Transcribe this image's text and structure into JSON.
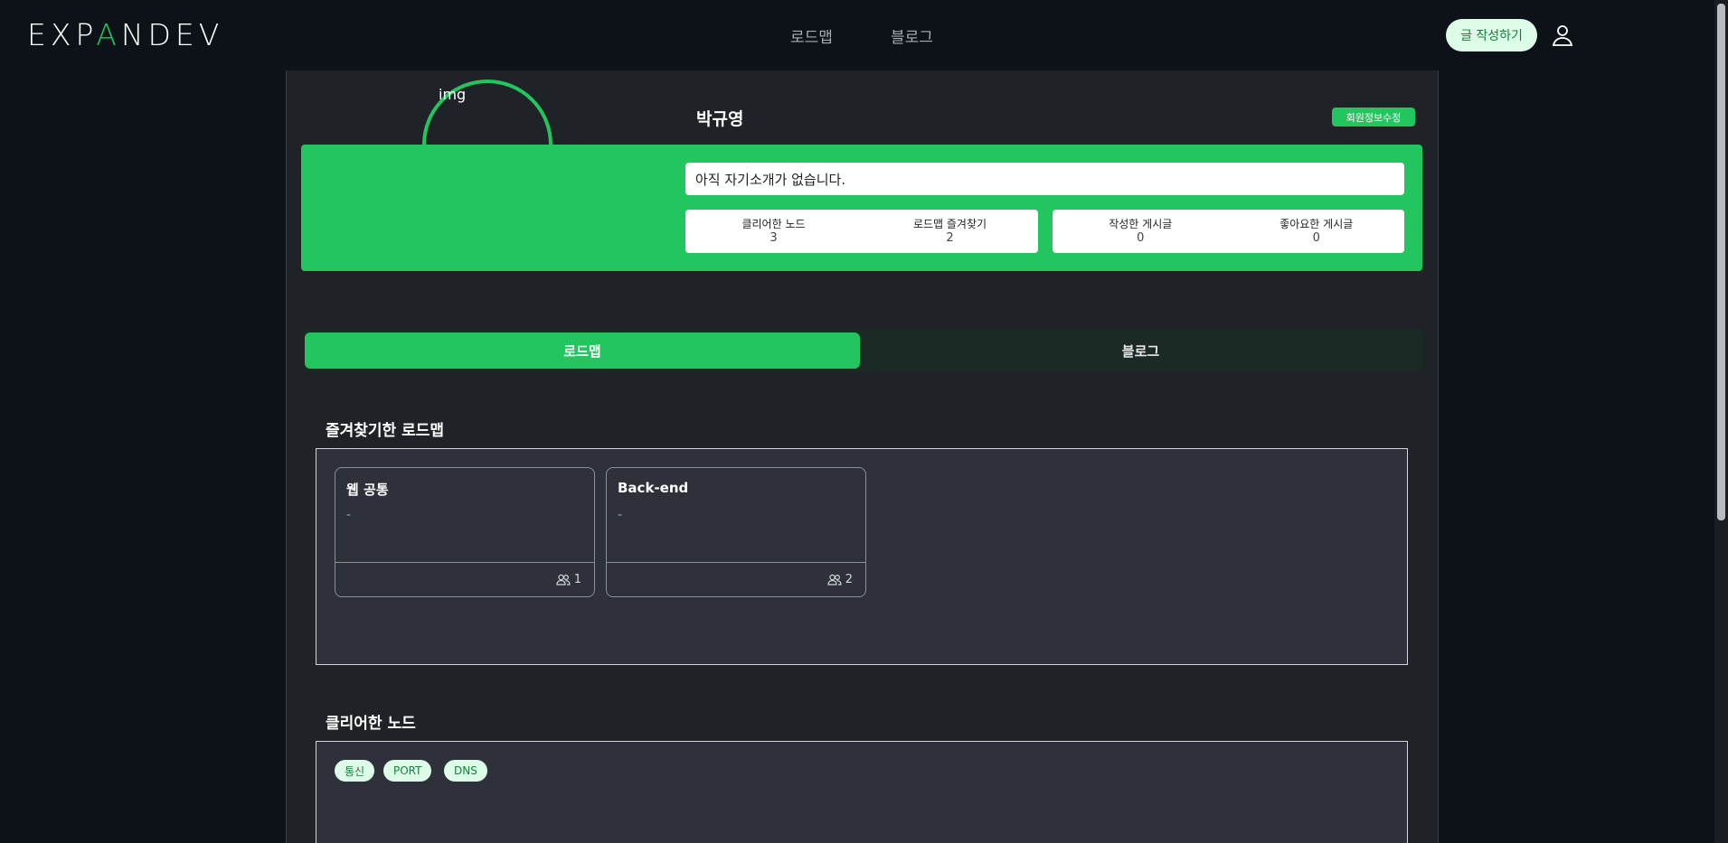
{
  "header": {
    "logo_pre": "EXP",
    "logo_accent": "A",
    "logo_post": "NDEV",
    "nav": {
      "roadmap": "로드맵",
      "blog": "블로그"
    },
    "write_button": "글 작성하기",
    "user_icon": "user-icon"
  },
  "profile": {
    "avatar_alt": "img",
    "name": "박규영",
    "edit_button": "회원정보수정",
    "intro": "아직 자기소개가 없습니다.",
    "stats": [
      {
        "label": "클리어한 노드",
        "value": "3"
      },
      {
        "label": "로드맵 즐겨찾기",
        "value": "2"
      },
      {
        "label": "작성한 게시글",
        "value": "0"
      },
      {
        "label": "좋아요한 게시글",
        "value": "0"
      }
    ]
  },
  "tabs": {
    "roadmap": "로드맵",
    "blog": "블로그",
    "active": "roadmap"
  },
  "favorites": {
    "title": "즐겨찾기한 로드맵",
    "cards": [
      {
        "title": "웹 공통",
        "desc": "-",
        "count": "1"
      },
      {
        "title": "Back-end",
        "desc": "-",
        "count": "2"
      }
    ]
  },
  "cleared": {
    "title": "클리어한 노드",
    "tags": [
      "통신",
      "PORT",
      "DNS"
    ]
  },
  "colors": {
    "accent": "#22c55e",
    "background": "#0d1219",
    "panel": "#1f2328",
    "tag_bg": "#dcfce7",
    "tag_text": "#15803d"
  }
}
